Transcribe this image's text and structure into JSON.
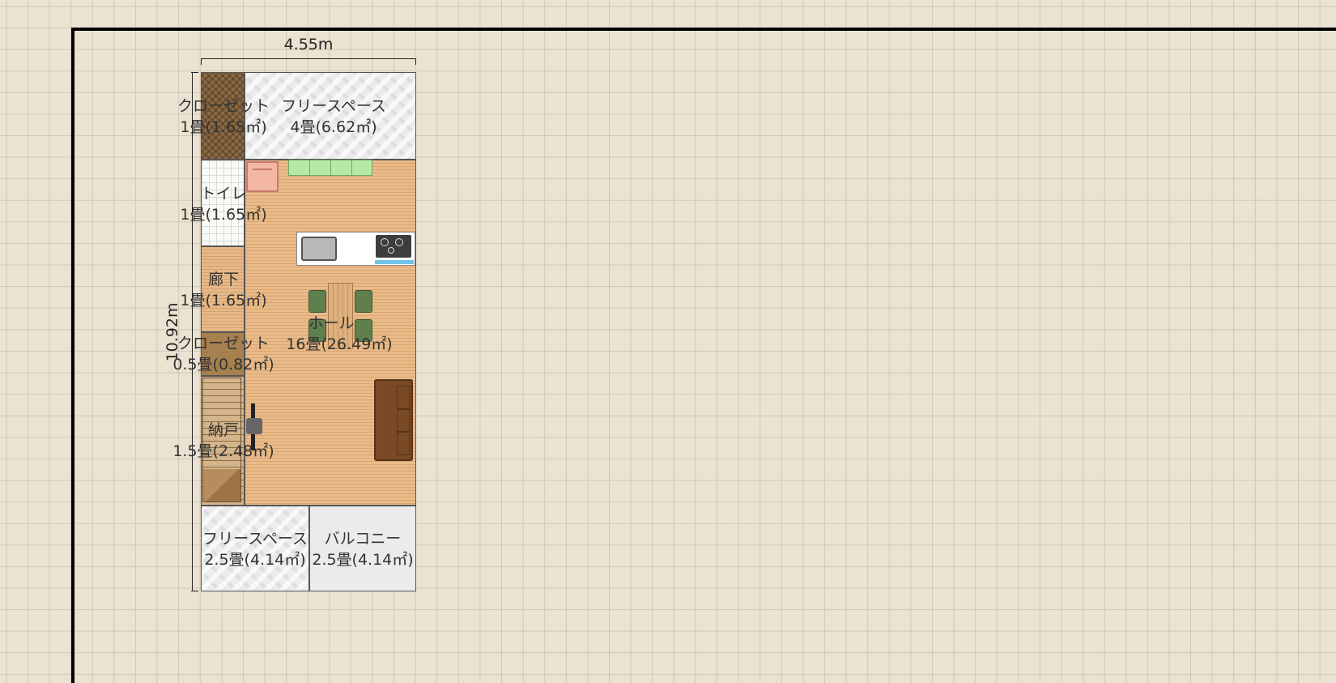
{
  "dimensions": {
    "width_label": "4.55m",
    "height_label": "10.92m"
  },
  "rooms": [
    {
      "name": "クローゼット",
      "area": "1畳(1.65㎡)"
    },
    {
      "name": "フリースペース",
      "area": "4畳(6.62㎡)"
    },
    {
      "name": "トイレ",
      "area": "1畳(1.65㎡)"
    },
    {
      "name": "廊下",
      "area": "1畳(1.65㎡)"
    },
    {
      "name": "ホール",
      "area": "16畳(26.49㎡)"
    },
    {
      "name": "クローゼット",
      "area": "0.5畳(0.82㎡)"
    },
    {
      "name": "納戸",
      "area": "1.5畳(2.48㎡)"
    },
    {
      "name": "フリースペース",
      "area": "2.5畳(4.14㎡)"
    },
    {
      "name": "バルコニー",
      "area": "2.5畳(4.14㎡)"
    }
  ],
  "colors": {
    "background": "#ebe2d1",
    "frame": "#000000",
    "wood_floor": "#e8b986",
    "closet": "#8b6a45",
    "sofa": "#7a4a26",
    "chair": "#5f7f4d",
    "counter": "#b6e8a6"
  },
  "icons": [
    "sink-icon",
    "stove-icon",
    "fridge-icon",
    "tv-icon",
    "sofa-icon",
    "stairs-icon",
    "dining-table-icon"
  ]
}
